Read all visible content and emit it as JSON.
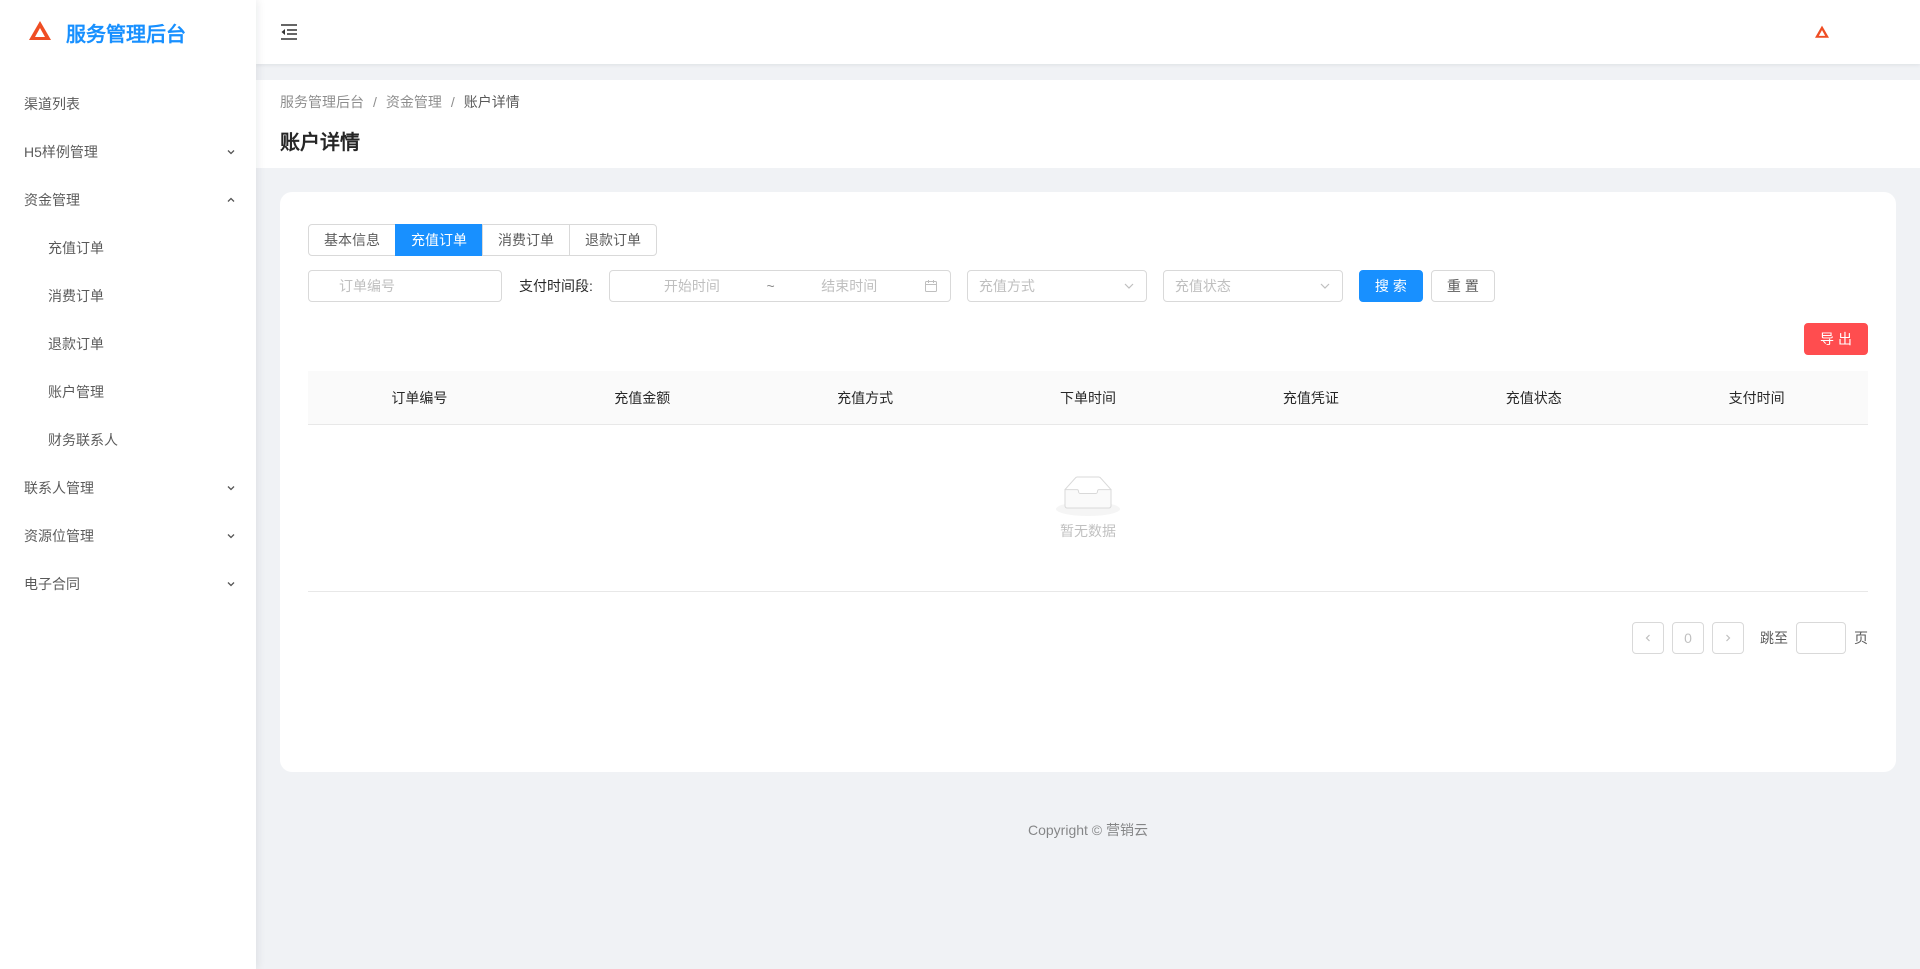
{
  "app": {
    "title": "服务管理后台"
  },
  "sidebar": {
    "items": [
      {
        "label": "渠道列表",
        "expandable": false
      },
      {
        "label": "H5样例管理",
        "expandable": true,
        "expanded": false
      },
      {
        "label": "资金管理",
        "expandable": true,
        "expanded": true
      },
      {
        "label": "充值订单",
        "sub": true
      },
      {
        "label": "消费订单",
        "sub": true
      },
      {
        "label": "退款订单",
        "sub": true
      },
      {
        "label": "账户管理",
        "sub": true
      },
      {
        "label": "财务联系人",
        "sub": true
      },
      {
        "label": "联系人管理",
        "expandable": true,
        "expanded": false
      },
      {
        "label": "资源位管理",
        "expandable": true,
        "expanded": false
      },
      {
        "label": "电子合同",
        "expandable": true,
        "expanded": false
      }
    ]
  },
  "breadcrumb": {
    "items": [
      "服务管理后台",
      "资金管理",
      "账户详情"
    ],
    "separator": "/"
  },
  "page": {
    "title": "账户详情"
  },
  "tabs": [
    {
      "label": "基本信息",
      "active": false
    },
    {
      "label": "充值订单",
      "active": true
    },
    {
      "label": "消费订单",
      "active": false
    },
    {
      "label": "退款订单",
      "active": false
    }
  ],
  "filters": {
    "order_no_placeholder": "订单编号",
    "pay_time_label": "支付时间段:",
    "start_placeholder": "开始时间",
    "range_sep": "~",
    "end_placeholder": "结束时间",
    "method_placeholder": "充值方式",
    "status_placeholder": "充值状态",
    "search_label": "搜索",
    "reset_label": "重置"
  },
  "export_label": "导出",
  "table": {
    "columns": [
      "订单编号",
      "充值金额",
      "充值方式",
      "下单时间",
      "充值凭证",
      "充值状态",
      "支付时间"
    ],
    "rows": [],
    "empty_text": "暂无数据"
  },
  "pagination": {
    "current": "0",
    "jump_prefix": "跳至",
    "jump_suffix": "页"
  },
  "footer": {
    "copyright": "Copyright © 营销云"
  },
  "colors": {
    "primary": "#1890ff",
    "danger": "#ff4d4f",
    "logo": "#ef4d23"
  }
}
